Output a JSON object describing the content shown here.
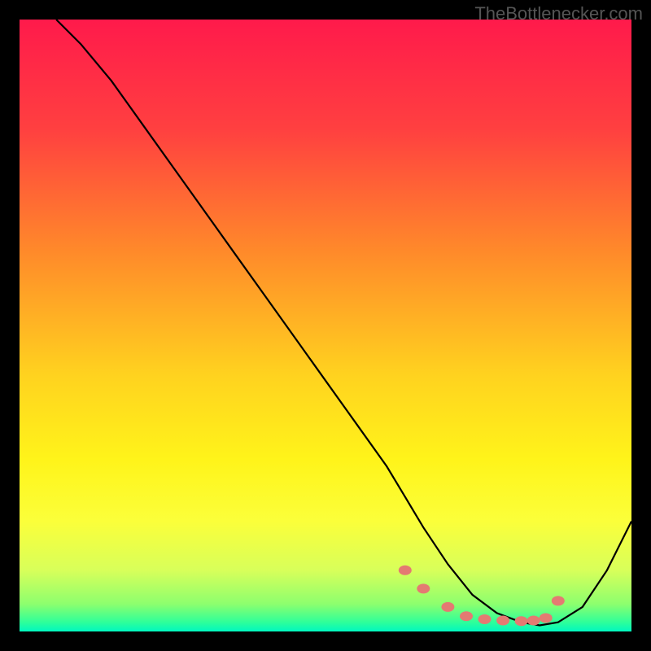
{
  "watermark": "TheBottlenecker.com",
  "chart_data": {
    "type": "line",
    "title": "",
    "xlabel": "",
    "ylabel": "",
    "xlim": [
      0,
      100
    ],
    "ylim": [
      0,
      100
    ],
    "series": [
      {
        "name": "curve",
        "x": [
          6,
          10,
          15,
          20,
          25,
          30,
          35,
          40,
          45,
          50,
          55,
          60,
          63,
          66,
          70,
          74,
          78,
          82,
          85,
          88,
          92,
          96,
          100
        ],
        "y": [
          100,
          96,
          90,
          83,
          76,
          69,
          62,
          55,
          48,
          41,
          34,
          27,
          22,
          17,
          11,
          6,
          3,
          1.5,
          1,
          1.5,
          4,
          10,
          18
        ]
      }
    ],
    "markers": {
      "name": "highlighted-points",
      "x": [
        63,
        66,
        70,
        73,
        76,
        79,
        82,
        84,
        86,
        88
      ],
      "y": [
        10,
        7,
        4,
        2.5,
        2,
        1.8,
        1.7,
        1.8,
        2.2,
        5
      ]
    },
    "gradient_stops": [
      {
        "offset": 0.0,
        "color": "#ff1a4b"
      },
      {
        "offset": 0.18,
        "color": "#ff4040"
      },
      {
        "offset": 0.38,
        "color": "#ff8a2a"
      },
      {
        "offset": 0.58,
        "color": "#ffd21f"
      },
      {
        "offset": 0.72,
        "color": "#fff41a"
      },
      {
        "offset": 0.82,
        "color": "#fbff3a"
      },
      {
        "offset": 0.9,
        "color": "#d8ff5a"
      },
      {
        "offset": 0.955,
        "color": "#8dff6e"
      },
      {
        "offset": 0.985,
        "color": "#2eff9a"
      },
      {
        "offset": 1.0,
        "color": "#00f7c0"
      }
    ],
    "marker_color": "#e47a72",
    "curve_color": "#000000"
  }
}
